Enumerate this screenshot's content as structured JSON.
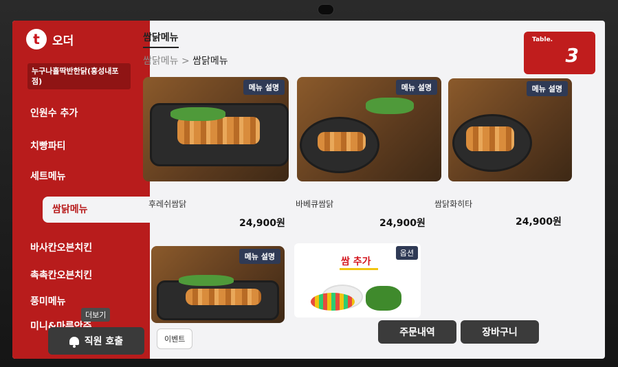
{
  "logo": {
    "text": "오더"
  },
  "sidebar": {
    "store_name": "누구나홀딱반한닭(홍성내포점)",
    "items": [
      {
        "label": "인원수 추가"
      },
      {
        "label": "치빵파티"
      },
      {
        "label": "세트메뉴"
      },
      {
        "label": "쌈닭메뉴"
      },
      {
        "label": "바사칸오븐치킨"
      },
      {
        "label": "촉촉칸오븐치킨"
      },
      {
        "label": "풍미메뉴"
      },
      {
        "label": "미니&마른안주"
      }
    ],
    "more_label": "더보기",
    "staff_call_label": "직원 호출"
  },
  "header": {
    "title": "쌈닭메뉴",
    "breadcrumb_parent": "쌈닭메뉴",
    "breadcrumb_separator": ">",
    "breadcrumb_current": "쌈닭메뉴"
  },
  "table": {
    "label": "Table.",
    "number": "3"
  },
  "products": [
    {
      "name": "후레쉬쌈닭",
      "price": "24,900원",
      "desc_button": "메뉴 설명"
    },
    {
      "name": "바베큐쌈닭",
      "price": "24,900원",
      "desc_button": "메뉴 설명"
    },
    {
      "name": "쌈닭화히타",
      "price": "24,900원",
      "desc_button": "메뉴 설명"
    },
    {
      "name": "",
      "price": "",
      "desc_button": "메뉴 설명"
    }
  ],
  "extra_card": {
    "title": "쌈 추가",
    "option_label": "옵션"
  },
  "bottom": {
    "event_label": "이벤트",
    "order_history_label": "주문내역",
    "cart_label": "장바구니"
  }
}
